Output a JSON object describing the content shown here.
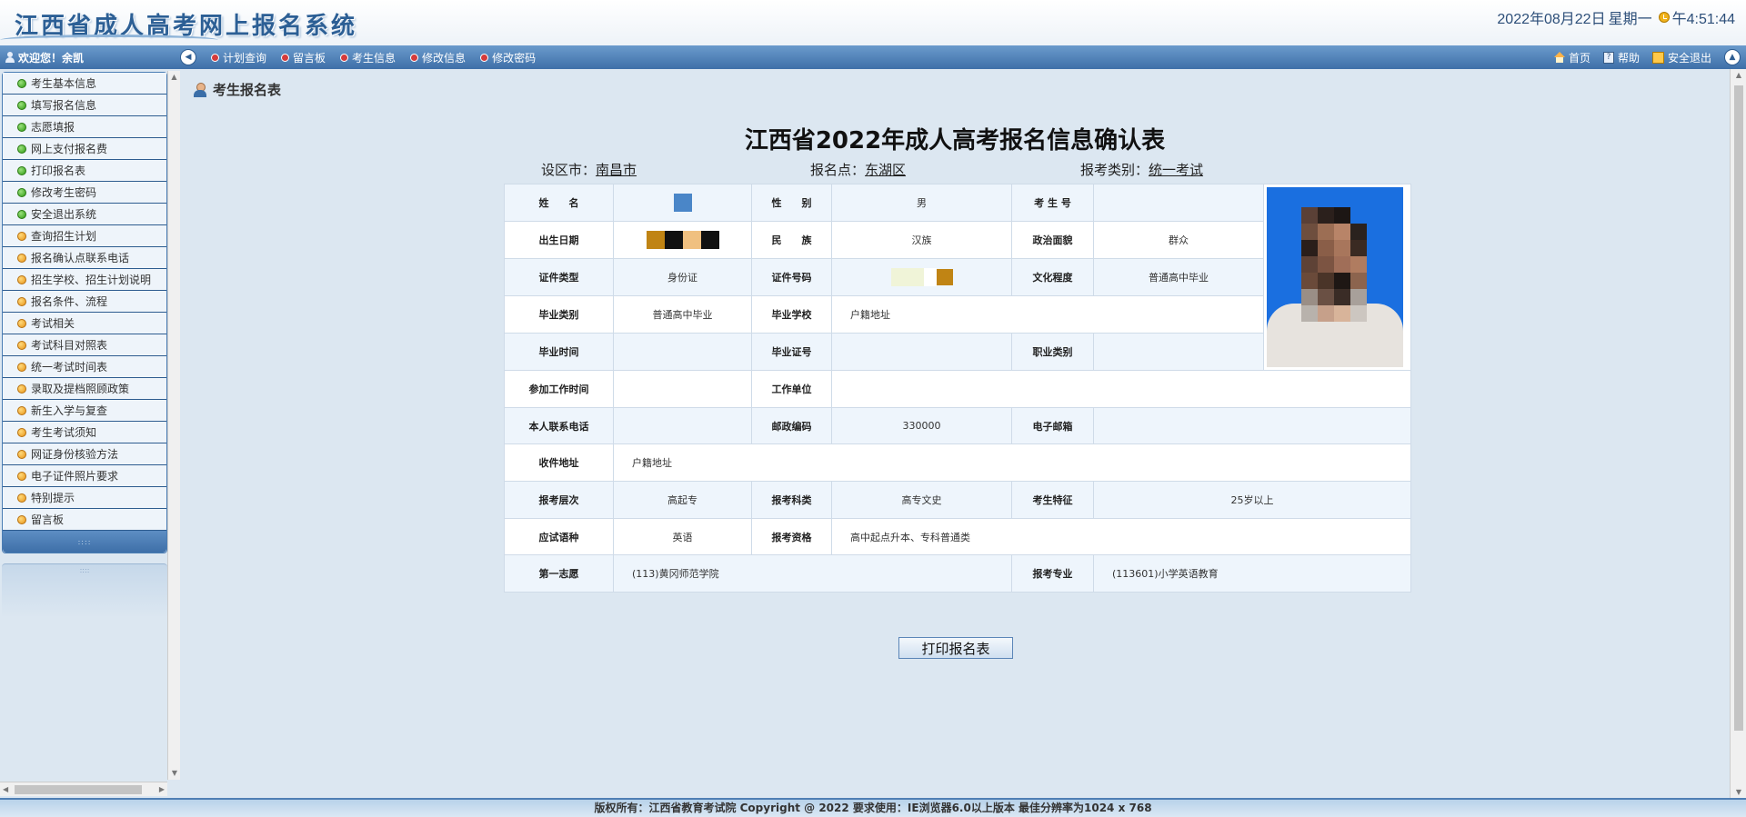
{
  "header": {
    "title": "江西省成人高考网上报名系统",
    "date": "2022年08月22日",
    "weekday": "星期一",
    "time": "午4:51:44"
  },
  "navbar": {
    "welcome": "欢迎您！余凯",
    "links": [
      {
        "label": "计划查询",
        "icon": "red-dot-icon"
      },
      {
        "label": "留言板",
        "icon": "red-dot-icon"
      },
      {
        "label": "考生信息",
        "icon": "red-dot-icon"
      },
      {
        "label": "修改信息",
        "icon": "red-dot-icon"
      },
      {
        "label": "修改密码",
        "icon": "red-dot-icon"
      }
    ],
    "right": {
      "home": "首页",
      "help": "帮助",
      "logout": "安全退出"
    }
  },
  "sidebar": {
    "items": [
      {
        "label": "考生基本信息",
        "icon": "green-dot-icon"
      },
      {
        "label": "填写报名信息",
        "icon": "green-dot-icon"
      },
      {
        "label": "志愿填报",
        "icon": "green-dot-icon"
      },
      {
        "label": "网上支付报名费",
        "icon": "green-dot-icon"
      },
      {
        "label": "打印报名表",
        "icon": "green-dot-icon"
      },
      {
        "label": "修改考生密码",
        "icon": "green-dot-icon"
      },
      {
        "label": "安全退出系统",
        "icon": "green-dot-icon"
      },
      {
        "label": "查询招生计划",
        "icon": "orange-dot-icon"
      },
      {
        "label": "报名确认点联系电话",
        "icon": "orange-dot-icon"
      },
      {
        "label": "招生学校、招生计划说明",
        "icon": "orange-dot-icon"
      },
      {
        "label": "报名条件、流程",
        "icon": "orange-dot-icon"
      },
      {
        "label": "考试相关",
        "icon": "orange-dot-icon"
      },
      {
        "label": "考试科目对照表",
        "icon": "orange-dot-icon"
      },
      {
        "label": "统一考试时间表",
        "icon": "orange-dot-icon"
      },
      {
        "label": "录取及提档照顾政策",
        "icon": "orange-dot-icon"
      },
      {
        "label": "新生入学与复查",
        "icon": "orange-dot-icon"
      },
      {
        "label": "考生考试须知",
        "icon": "orange-dot-icon"
      },
      {
        "label": "网证身份核验方法",
        "icon": "orange-dot-icon"
      },
      {
        "label": "电子证件照片要求",
        "icon": "orange-dot-icon"
      },
      {
        "label": "特别提示",
        "icon": "orange-dot-icon"
      },
      {
        "label": "留言板",
        "icon": "orange-dot-icon"
      }
    ]
  },
  "main": {
    "section_title": "考生报名表",
    "form_title": "江西省2022年成人高考报名信息确认表",
    "meta": {
      "city_label": "设区市：",
      "city": "南昌市",
      "site_label": "报名点：",
      "site": "东湖区",
      "type_label": "报考类别：",
      "type": "统一考试"
    },
    "table": {
      "name_label": "姓　　名",
      "name": "",
      "gender_label": "性　　别",
      "gender": "男",
      "exam_no_label": "考 生 号",
      "exam_no": "",
      "birth_label": "出生日期",
      "birth": "",
      "nation_label": "民　　族",
      "nation": "汉族",
      "politics_label": "政治面貌",
      "politics": "群众",
      "id_type_label": "证件类型",
      "id_type": "身份证",
      "id_no_label": "证件号码",
      "id_no": "",
      "edu_label": "文化程度",
      "edu": "普通高中毕业",
      "grad_type_label": "毕业类别",
      "grad_type": "普通高中毕业",
      "grad_school_label": "毕业学校",
      "grad_school": "户籍地址",
      "grad_time_label": "毕业时间",
      "grad_time": "",
      "grad_cert_label": "毕业证号",
      "grad_cert": "",
      "job_type_label": "职业类别",
      "job_type": "",
      "work_time_label": "参加工作时间",
      "work_time": "",
      "employer_label": "工作单位",
      "employer": "",
      "phone_label": "本人联系电话",
      "phone": "",
      "zip_label": "邮政编码",
      "zip": "330000",
      "email_label": "电子邮箱",
      "email": "",
      "address_label": "收件地址",
      "address": "户籍地址",
      "level_label": "报考层次",
      "level": "高起专",
      "subject_label": "报考科类",
      "subject": "高专文史",
      "feature_label": "考生特征",
      "feature": "25岁以上",
      "language_label": "应试语种",
      "language": "英语",
      "qualification_label": "报考资格",
      "qualification": "高中起点升本、专科普通类",
      "first_choice_label": "第一志愿",
      "first_choice": "(113)黄冈师范学院",
      "major_label": "报考专业",
      "major": "(113601)小学英语教育"
    },
    "print_button": "打印报名表"
  },
  "footer": {
    "text": "版权所有：江西省教育考试院 Copyright @ 2022 要求使用：IE浏览器6.0以上版本 最佳分辨率为1024 x 768"
  }
}
